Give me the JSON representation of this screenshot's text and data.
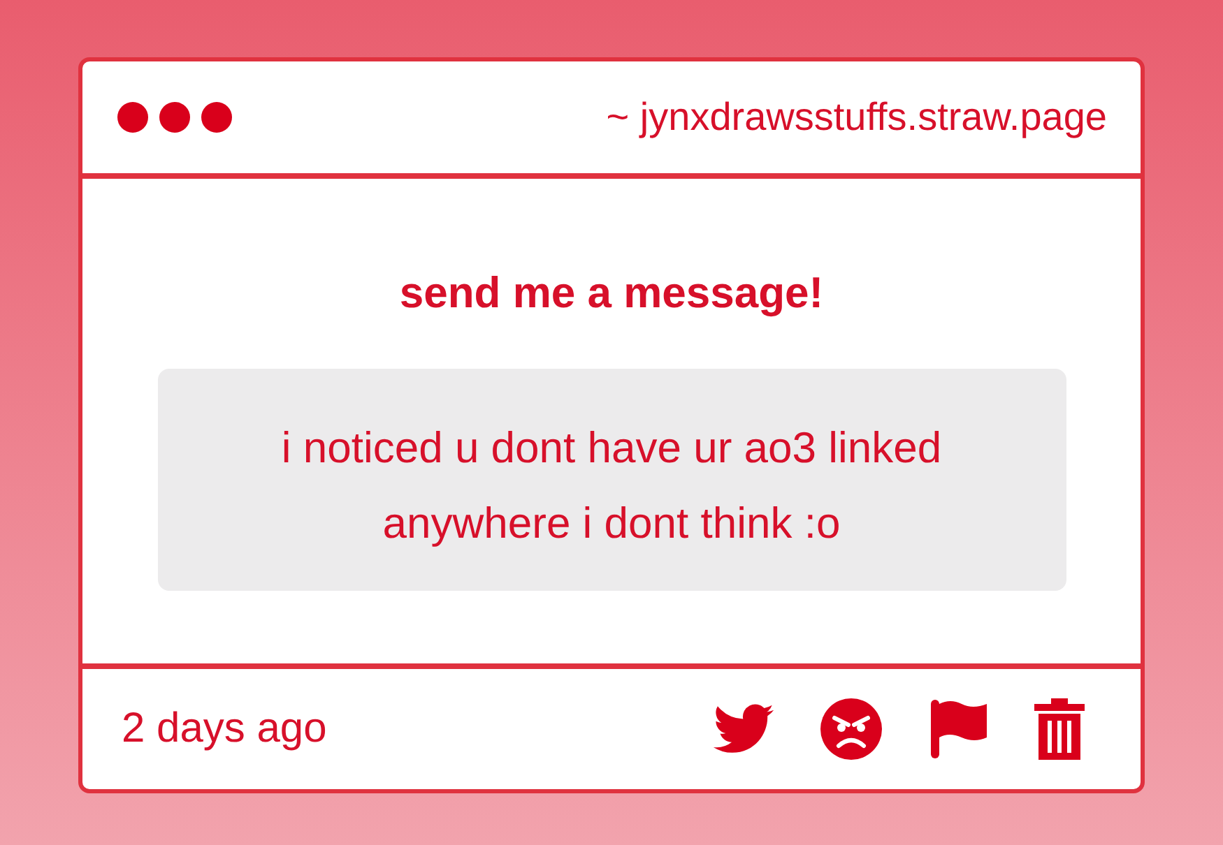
{
  "header": {
    "url": "~ jynxdrawsstuffs.straw.page"
  },
  "title": "send me a message!",
  "message": "i noticed u dont have ur ao3 linked anywhere i dont think :o",
  "footer": {
    "time": "2 days ago"
  }
}
